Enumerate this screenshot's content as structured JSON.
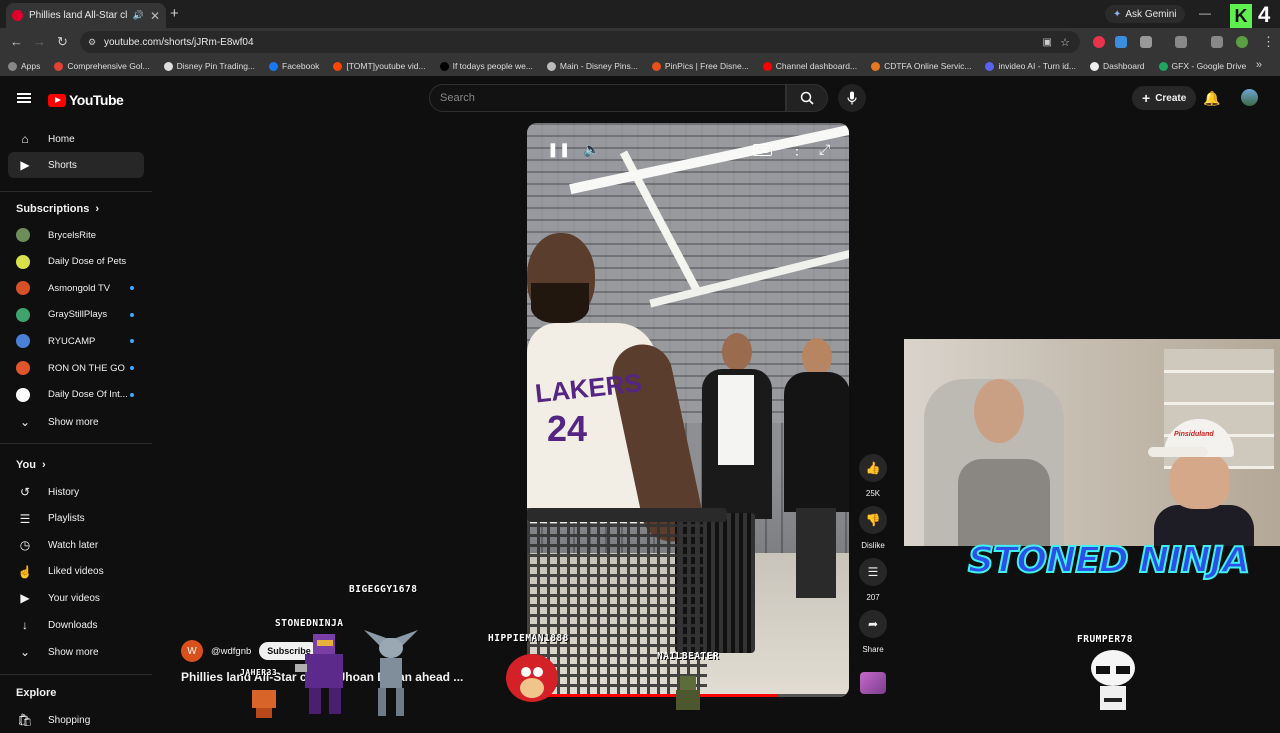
{
  "browser": {
    "tab_title": "Phillies land All-Star closer",
    "url": "youtube.com/shorts/jJRm-E8wf04",
    "ask_gemini": "Ask Gemini",
    "bookmarks": [
      {
        "label": "Apps",
        "color": "#888888"
      },
      {
        "label": "Comprehensive Gol...",
        "color": "#e34133"
      },
      {
        "label": "Disney Pin Trading...",
        "color": "#dddddd"
      },
      {
        "label": "Facebook",
        "color": "#1877f2"
      },
      {
        "label": "[TOMT]youtube vid...",
        "color": "#ff4500"
      },
      {
        "label": "If todays people we...",
        "color": "#000000"
      },
      {
        "label": "Main - Disney Pins...",
        "color": "#bbbbbb"
      },
      {
        "label": "PinPics | Free Disne...",
        "color": "#e8501c"
      },
      {
        "label": "Channel dashboard...",
        "color": "#ff0000"
      },
      {
        "label": "CDTFA Online Servic...",
        "color": "#e87722"
      },
      {
        "label": "invideo AI - Turn id...",
        "color": "#5a63f0"
      },
      {
        "label": "Dashboard",
        "color": "#eeeeee"
      },
      {
        "label": "GFX - Google Drive",
        "color": "#1fa463"
      }
    ],
    "overlay_number": "4"
  },
  "youtube": {
    "logo_text": "YouTube",
    "search_placeholder": "Search",
    "create_label": "Create"
  },
  "sidebar": {
    "main": [
      {
        "label": "Home",
        "icon": "home-icon"
      },
      {
        "label": "Shorts",
        "icon": "shorts-icon"
      }
    ],
    "subscriptions_heading": "Subscriptions",
    "subscriptions": [
      {
        "label": "BrycelsRite",
        "color": "#6b8e5a",
        "dot": false
      },
      {
        "label": "Daily Dose of Pets",
        "color": "#d8e04a",
        "dot": false
      },
      {
        "label": "Asmongold TV",
        "color": "#d7502a",
        "dot": true
      },
      {
        "label": "GrayStillPlays",
        "color": "#3fa36b",
        "dot": true
      },
      {
        "label": "RYUCAMP",
        "color": "#4a7fd6",
        "dot": true
      },
      {
        "label": "RON ON THE GO",
        "color": "#e2552c",
        "dot": true
      },
      {
        "label": "Daily Dose Of Int...",
        "color": "#ffffff",
        "dot": true
      }
    ],
    "show_more": "Show more",
    "you_heading": "You",
    "you_items": [
      {
        "label": "History",
        "icon": "history-icon"
      },
      {
        "label": "Playlists",
        "icon": "playlists-icon"
      },
      {
        "label": "Watch later",
        "icon": "watch-later-icon"
      },
      {
        "label": "Liked videos",
        "icon": "liked-videos-icon"
      },
      {
        "label": "Your videos",
        "icon": "your-videos-icon"
      },
      {
        "label": "Downloads",
        "icon": "downloads-icon"
      }
    ],
    "show_more_2": "Show more",
    "explore_heading": "Explore",
    "explore_first": "Shopping"
  },
  "short": {
    "channel_initial": "W",
    "channel": "@wdfgnb",
    "subscribe_label": "Subscribe",
    "title": "Phillies land All-Star closer Jhoan Duran ahead ...",
    "like_count": "25K",
    "dislike_label": "Dislike",
    "comment_count": "207",
    "share_label": "Share",
    "progress": 0.78,
    "jersey_text": "LAKERS",
    "jersey_number": "24"
  },
  "stream_overlay": {
    "banner": "STONED NINJA",
    "chat_names": [
      "BIGEGGY1678",
      "STONEDNINJA",
      "HIPPIEMAN1888",
      "NAILBEATER",
      "FRUMPER78",
      "JAHER33"
    ],
    "cap_text": "Pinsiduland"
  }
}
